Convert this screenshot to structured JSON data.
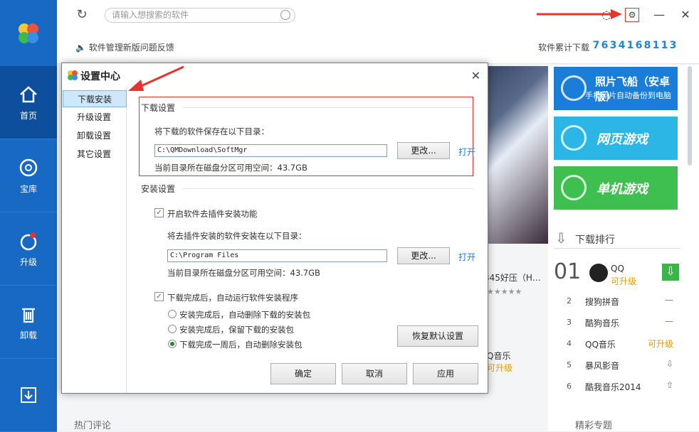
{
  "topbar": {
    "search_placeholder": "请输入想搜索的软件"
  },
  "subbar": {
    "feedback": "软件管理新版问题反馈",
    "download_label": "软件累计下载",
    "download_count": [
      "7",
      "6",
      "3",
      "4",
      "1",
      "6",
      "8",
      "1",
      "1",
      "3"
    ]
  },
  "rail": {
    "items": [
      {
        "label": "首页",
        "icon": "home-icon"
      },
      {
        "label": "宝库",
        "icon": "disc-icon"
      },
      {
        "label": "升级",
        "icon": "upgrade-icon"
      },
      {
        "label": "卸载",
        "icon": "trash-icon"
      },
      {
        "label": "",
        "icon": "download-icon"
      }
    ]
  },
  "right": {
    "tile_photo_title": "照片飞船（安卓版）",
    "tile_photo_sub": "手机照片自动备份到电脑",
    "tile_web": "网页游戏",
    "tile_single": "单机游戏",
    "rank_title": "下载排行",
    "rank1": {
      "num": "01",
      "name": "QQ",
      "status": "可升级"
    },
    "rows": [
      {
        "n": "2",
        "name": "搜狗拼音",
        "status": "—"
      },
      {
        "n": "3",
        "name": "酷狗音乐",
        "status": "—"
      },
      {
        "n": "4",
        "name": "QQ音乐",
        "status": "可升级"
      },
      {
        "n": "5",
        "name": "暴风影音",
        "status": "⇩"
      },
      {
        "n": "6",
        "name": "酷我音乐2014",
        "status": "⇧"
      }
    ],
    "special": "精彩专题"
  },
  "main": {
    "partial1": "345好压（H…",
    "partial1b": "★★★★★",
    "partial2": "Q音乐",
    "partial2b": "可升级",
    "hot_comment": "热门评论"
  },
  "dialog": {
    "title": "设置中心",
    "nav": [
      "下载安装",
      "升级设置",
      "卸载设置",
      "其它设置"
    ],
    "download_section": "下载设置",
    "download_label": "将下载的软件保存在以下目录：",
    "download_path": "C:\\QMDownload\\SoftMgr",
    "change_label": "更改...",
    "open_label": "打开",
    "download_space": "当前目录所在磁盘分区可用空间：43.7GB",
    "install_section": "安装设置",
    "plugin_check": "开启软件去插件安装功能",
    "install_label": "将去插件安装的软件安装在以下目录：",
    "install_path": "C:\\Program Files",
    "install_space": "当前目录所在磁盘分区可用空间：43.7GB",
    "auto_install_check": "下载完成后，自动运行软件安装程序",
    "radio1": "安装完成后，自动删除下载的安装包",
    "radio2": "安装完成后，保留下载的安装包",
    "radio3": "下载完成一周后，自动删除安装包",
    "restore_label": "恢复默认设置",
    "ok_label": "确定",
    "cancel_label": "取消",
    "apply_label": "应用"
  },
  "colors": {
    "rail": "#1769c4",
    "accent": "#1f7ad8",
    "highlight": "#e8332a",
    "upgrade": "#f39800"
  }
}
